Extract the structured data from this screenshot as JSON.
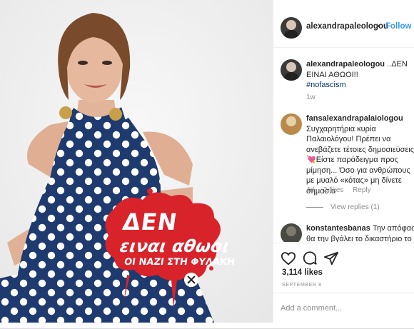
{
  "post": {
    "author": "alexandrapaleologou",
    "follow_label": "Follow",
    "separator": "•",
    "caption": {
      "user": "alexandrapaleologou",
      "text": "..ΔΕΝ ΕΙΝΑΙ ΑΘΩΟΙ!!",
      "hashtag": "#nofascism",
      "time": "1w"
    },
    "comments": [
      {
        "user": "fansalexandrapalaiologou",
        "text": "Συγχαρητήρια κυρία Παλαιολόγου! Πρέπει να ανεβάζετε τέτοιες δημοσιεύσεις! 💘Είστε παράδειγμα προς μίμηση... Όσο για ανθρώπους με μυαλό «κότας» μη δίνετε σημασία",
        "time": "4d",
        "likes": "2 likes",
        "reply": "Reply",
        "view_replies": "View replies (1)"
      },
      {
        "user": "konstantesbanas",
        "text": "Την απόφαση θα την βγάλει το δικαστήριο το"
      }
    ],
    "like_count": "3,114 likes",
    "date": "SEPTEMBER 8",
    "add_comment_placeholder": "Add a comment..."
  },
  "sticker": {
    "line1": "ΔΕΝ",
    "line2": "ειναι αθωοι",
    "line3": "ΟΙ ΝΑΖΙ ΣΤΗ ΦΥΛΑΚΗ",
    "color": "#d8232a"
  },
  "icons": {
    "like": "heart-icon",
    "comment": "comment-bubble-icon",
    "share": "paper-plane-icon"
  },
  "colors": {
    "link": "#3897f0",
    "dress": "#1f3a6e",
    "muted": "#8e8e8e"
  }
}
